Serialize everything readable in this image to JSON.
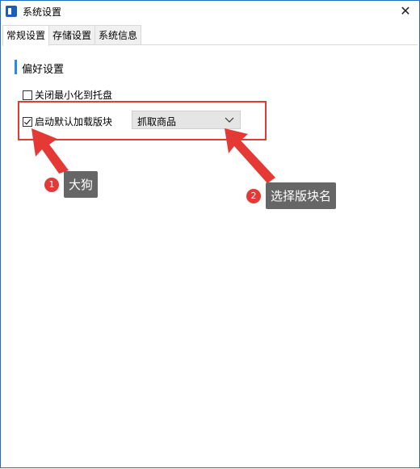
{
  "window": {
    "title": "系统设置",
    "close_icon": "close-icon"
  },
  "tabs": [
    {
      "label": "常规设置",
      "active": true
    },
    {
      "label": "存储设置",
      "active": false
    },
    {
      "label": "系统信息",
      "active": false
    }
  ],
  "section": {
    "title": "偏好设置"
  },
  "options": {
    "minimize_to_tray": {
      "label": "关闭最小化到托盘",
      "checked": false
    },
    "auto_load_module": {
      "label": "启动默认加载版块",
      "checked": true
    }
  },
  "module_select": {
    "value": "抓取商品"
  },
  "annotations": [
    {
      "number": "1",
      "text": "大狗"
    },
    {
      "number": "2",
      "text": "选择版块名"
    }
  ],
  "colors": {
    "accent": "#2b89e0",
    "annotation_red": "#e53935",
    "label_bg": "#666666"
  }
}
